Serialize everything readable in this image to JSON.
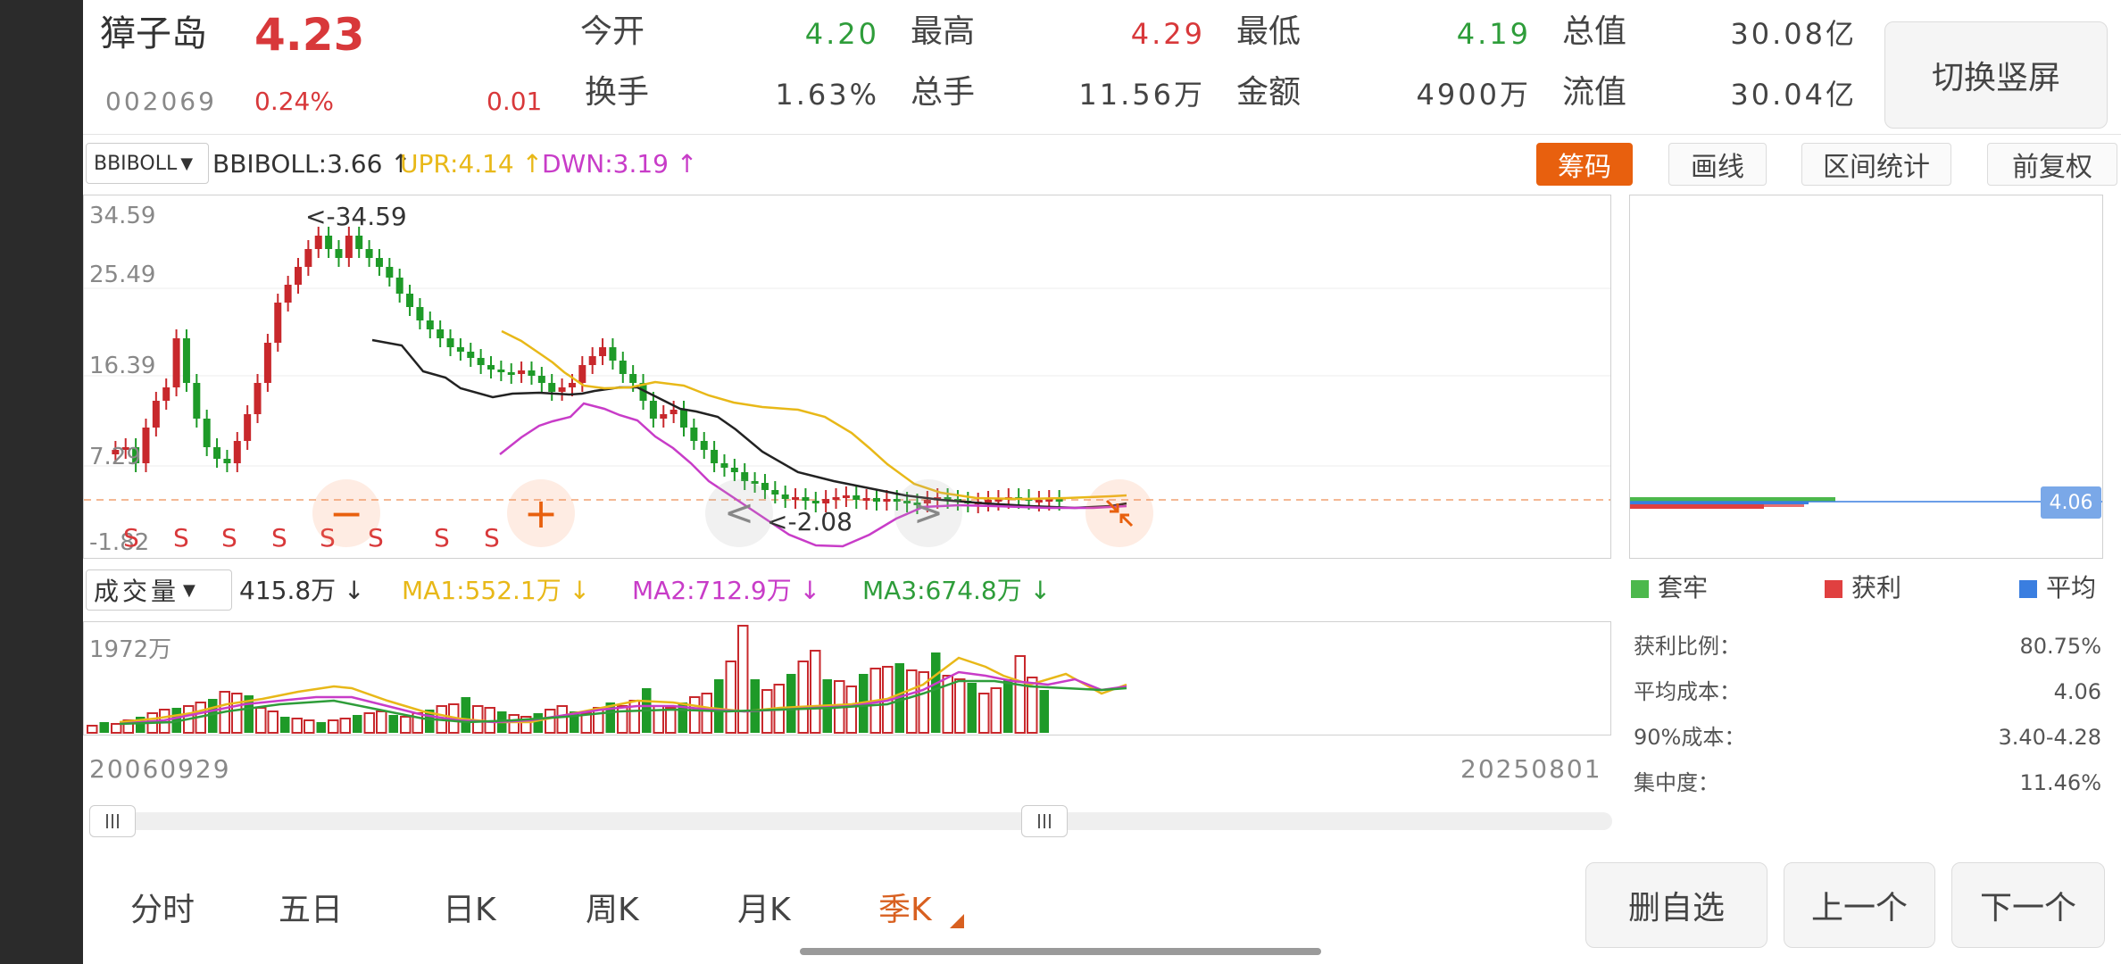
{
  "header": {
    "stock_name": "獐子岛",
    "price": "4.23",
    "code": "002069",
    "change_pct": "0.24%",
    "change": "0.01",
    "stats": [
      {
        "label": "今开",
        "value": "4.20",
        "color": "#2e9d3a"
      },
      {
        "label": "最高",
        "value": "4.29",
        "color": "#d8383a"
      },
      {
        "label": "最低",
        "value": "4.19",
        "color": "#2e9d3a"
      },
      {
        "label": "总值",
        "value": "30.08亿",
        "color": "#444444"
      },
      {
        "label": "换手",
        "value": "1.63%",
        "color": "#444444"
      },
      {
        "label": "总手",
        "value": "11.56万",
        "color": "#444444"
      },
      {
        "label": "金额",
        "value": "4900万",
        "color": "#444444"
      },
      {
        "label": "流值",
        "value": "30.04亿",
        "color": "#444444"
      }
    ],
    "switch_button": "切换竖屏"
  },
  "indicator_bar": {
    "selector": "BBIBOLL",
    "bbiboll": "BBIBOLL:3.66 ↑",
    "upr": "UPR:4.14 ↑",
    "dwn": "DWN:3.19 ↑",
    "buttons": [
      "筹码",
      "画线",
      "区间统计",
      "前复权"
    ],
    "active_color": "#e8600e"
  },
  "main_chart": {
    "y_labels": [
      "34.59",
      "25.49",
      "16.39",
      "7.29",
      "-1.82"
    ],
    "max_marker": "<-34.59",
    "min_marker": "<-2.08",
    "s_marker": "S",
    "nav_prev": "<",
    "nav_next": ">",
    "zoom_out": "−",
    "zoom_in": "+",
    "dashed_line_color": "#f0a070"
  },
  "volume": {
    "selector": "成交量",
    "vol": "415.8万 ↓",
    "ma1": "MA1:552.1万 ↓",
    "ma2": "MA2:712.9万 ↓",
    "ma3": "MA3:674.8万 ↓",
    "max_label": "1972万",
    "date_start": "20060929",
    "date_end": "20250801"
  },
  "chips": {
    "price_tag": "4.06",
    "legend": [
      {
        "label": "套牢",
        "color": "#4cb84c"
      },
      {
        "label": "获利",
        "color": "#e04040"
      },
      {
        "label": "平均",
        "color": "#3a7ee0"
      }
    ],
    "stats": [
      {
        "label": "获利比例：",
        "value": "80.75%"
      },
      {
        "label": "平均成本：",
        "value": "4.06"
      },
      {
        "label": "90%成本：",
        "value": "3.40-4.28"
      },
      {
        "label": "集中度：",
        "value": "11.46%"
      }
    ]
  },
  "tabs": {
    "items": [
      "分时",
      "五日",
      "日K",
      "周K",
      "月K",
      "季K"
    ],
    "active_index": 5,
    "active_color": "#d86020"
  },
  "actions": [
    "删自选",
    "上一个",
    "下一个"
  ],
  "colors": {
    "up": "#c8282c",
    "down": "#1e9a28",
    "ma_black": "#222222",
    "ma_yellow": "#e8b818",
    "ma_magenta": "#c83cc8"
  }
}
